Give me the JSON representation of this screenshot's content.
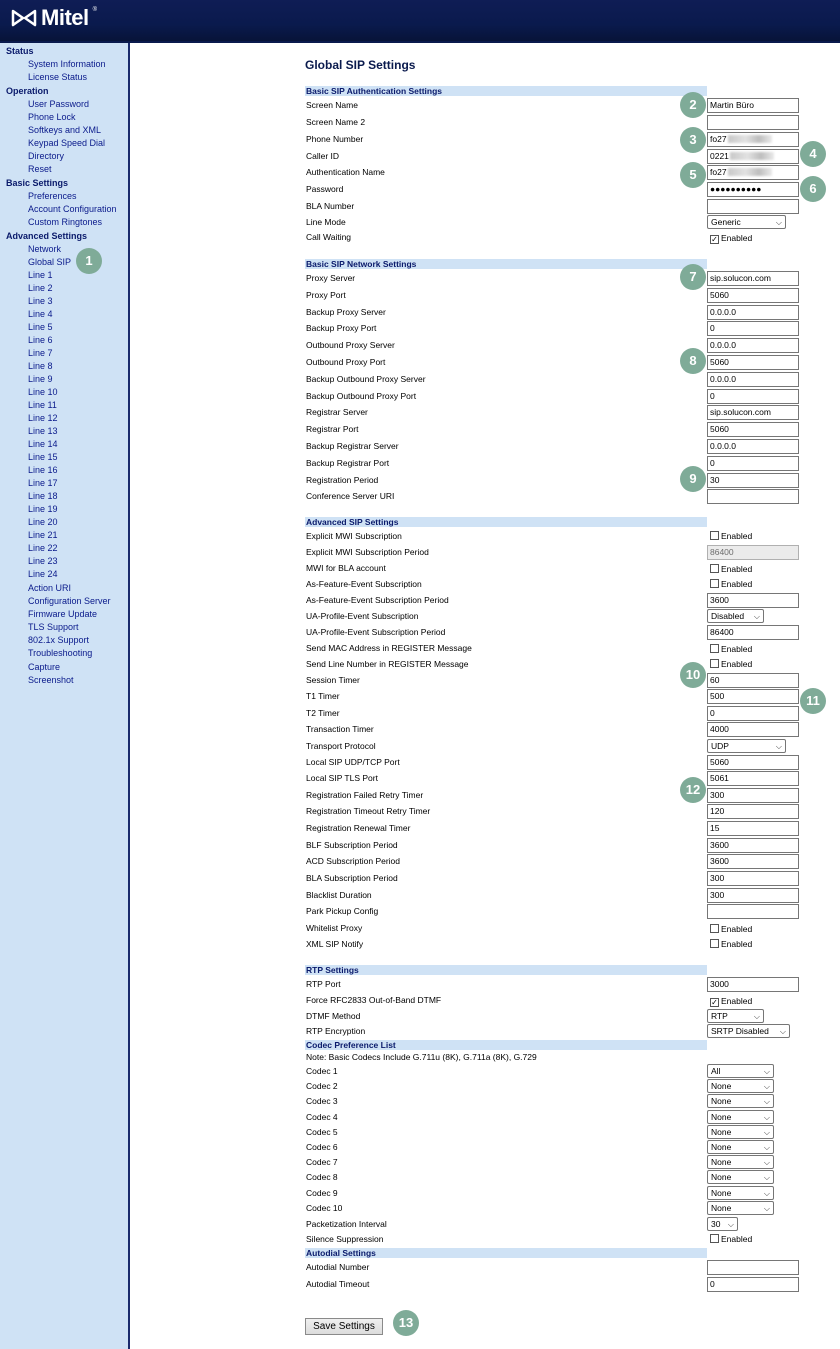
{
  "brand": {
    "name": "Mitel"
  },
  "page_title": "Global SIP Settings",
  "sidebar": {
    "sections": [
      {
        "title": "Status",
        "items": [
          "System Information",
          "License Status"
        ]
      },
      {
        "title": "Operation",
        "items": [
          "User Password",
          "Phone Lock",
          "Softkeys and XML",
          "Keypad Speed Dial",
          "Directory",
          "Reset"
        ]
      },
      {
        "title": "Basic Settings",
        "items": [
          "Preferences",
          "Account Configuration",
          "Custom Ringtones"
        ]
      },
      {
        "title": "Advanced Settings",
        "items": [
          "Network",
          "Global SIP",
          "Line 1",
          "Line 2",
          "Line 3",
          "Line 4",
          "Line 5",
          "Line 6",
          "Line 7",
          "Line 8",
          "Line 9",
          "Line 10",
          "Line 11",
          "Line 12",
          "Line 13",
          "Line 14",
          "Line 15",
          "Line 16",
          "Line 17",
          "Line 18",
          "Line 19",
          "Line 20",
          "Line 21",
          "Line 22",
          "Line 23",
          "Line 24",
          "Action URI",
          "Configuration Server",
          "Firmware Update",
          "TLS Support",
          "802.1x Support",
          "Troubleshooting",
          "Capture",
          "Screenshot"
        ]
      }
    ]
  },
  "enabled_label": "Enabled",
  "auth": {
    "title": "Basic SIP Authentication Settings",
    "screen_name_label": "Screen Name",
    "screen_name": "Martin Büro",
    "screen_name2_label": "Screen Name 2",
    "screen_name2": "",
    "phone_number_label": "Phone Number",
    "phone_number": "fo27",
    "caller_id_label": "Caller ID",
    "caller_id": "0221",
    "auth_name_label": "Authentication Name",
    "auth_name": "fo27",
    "password_label": "Password",
    "password": "●●●●●●●●●●",
    "bla_number_label": "BLA Number",
    "bla_number": "",
    "line_mode_label": "Line Mode",
    "line_mode": "Generic",
    "call_waiting_label": "Call Waiting"
  },
  "network": {
    "title": "Basic SIP Network Settings",
    "rows": [
      {
        "label": "Proxy Server",
        "value": "sip.solucon.com"
      },
      {
        "label": "Proxy Port",
        "value": "5060"
      },
      {
        "label": "Backup Proxy Server",
        "value": "0.0.0.0"
      },
      {
        "label": "Backup Proxy Port",
        "value": "0"
      },
      {
        "label": "Outbound Proxy Server",
        "value": "0.0.0.0"
      },
      {
        "label": "Outbound Proxy Port",
        "value": "5060"
      },
      {
        "label": "Backup Outbound Proxy Server",
        "value": "0.0.0.0"
      },
      {
        "label": "Backup Outbound Proxy Port",
        "value": "0"
      },
      {
        "label": "Registrar Server",
        "value": "sip.solucon.com"
      },
      {
        "label": "Registrar Port",
        "value": "5060"
      },
      {
        "label": "Backup Registrar Server",
        "value": "0.0.0.0"
      },
      {
        "label": "Backup Registrar Port",
        "value": "0"
      },
      {
        "label": "Registration Period",
        "value": "30"
      },
      {
        "label": "Conference Server URI",
        "value": ""
      }
    ]
  },
  "advanced": {
    "title": "Advanced SIP Settings",
    "explicit_mwi_label": "Explicit MWI Subscription",
    "explicit_mwi_period_label": "Explicit MWI Subscription Period",
    "explicit_mwi_period": "86400",
    "mwi_bla_label": "MWI for BLA account",
    "as_feature_label": "As-Feature-Event Subscription",
    "as_feature_period_label": "As-Feature-Event Subscription Period",
    "as_feature_period": "3600",
    "ua_profile_label": "UA-Profile-Event Subscription",
    "ua_profile": "Disabled",
    "ua_profile_period_label": "UA-Profile-Event Subscription Period",
    "ua_profile_period": "86400",
    "send_mac_label": "Send MAC Address in REGISTER Message",
    "send_line_label": "Send Line Number in REGISTER Message",
    "session_timer_label": "Session Timer",
    "session_timer": "60",
    "t1_timer_label": "T1 Timer",
    "t1_timer": "500",
    "t2_timer_label": "T2 Timer",
    "t2_timer": "0",
    "transaction_timer_label": "Transaction Timer",
    "transaction_timer": "4000",
    "transport_label": "Transport Protocol",
    "transport": "UDP",
    "udp_port_label": "Local SIP UDP/TCP Port",
    "udp_port": "5060",
    "tls_port_label": "Local SIP TLS Port",
    "tls_port": "5061",
    "reg_failed_label": "Registration Failed Retry Timer",
    "reg_failed": "300",
    "reg_timeout_label": "Registration Timeout Retry Timer",
    "reg_timeout": "120",
    "reg_renewal_label": "Registration Renewal Timer",
    "reg_renewal": "15",
    "blf_period_label": "BLF Subscription Period",
    "blf_period": "3600",
    "acd_period_label": "ACD Subscription Period",
    "acd_period": "3600",
    "bla_period_label": "BLA Subscription Period",
    "bla_period": "300",
    "blacklist_label": "Blacklist Duration",
    "blacklist": "300",
    "park_pickup_label": "Park Pickup Config",
    "park_pickup": "",
    "whitelist_label": "Whitelist Proxy",
    "xml_notify_label": "XML SIP Notify"
  },
  "rtp": {
    "title": "RTP Settings",
    "rtp_port_label": "RTP Port",
    "rtp_port": "3000",
    "force_dtmf_label": "Force RFC2833 Out-of-Band DTMF",
    "dtmf_method_label": "DTMF Method",
    "dtmf_method": "RTP",
    "encryption_label": "RTP Encryption",
    "encryption": "SRTP Disabled"
  },
  "codec": {
    "title": "Codec Preference List",
    "note": "Note: Basic Codecs Include G.711u (8K), G.711a (8K), G.729",
    "codecs": [
      {
        "label": "Codec 1",
        "value": "All"
      },
      {
        "label": "Codec 2",
        "value": "None"
      },
      {
        "label": "Codec 3",
        "value": "None"
      },
      {
        "label": "Codec 4",
        "value": "None"
      },
      {
        "label": "Codec 5",
        "value": "None"
      },
      {
        "label": "Codec 6",
        "value": "None"
      },
      {
        "label": "Codec 7",
        "value": "None"
      },
      {
        "label": "Codec 8",
        "value": "None"
      },
      {
        "label": "Codec 9",
        "value": "None"
      },
      {
        "label": "Codec 10",
        "value": "None"
      }
    ],
    "packetization_label": "Packetization Interval",
    "packetization": "30",
    "silence_label": "Silence Suppression"
  },
  "autodial": {
    "title": "Autodial Settings",
    "number_label": "Autodial Number",
    "number": "",
    "timeout_label": "Autodial Timeout",
    "timeout": "0"
  },
  "save_label": "Save Settings",
  "badges": [
    "1",
    "2",
    "3",
    "4",
    "5",
    "6",
    "7",
    "8",
    "9",
    "10",
    "11",
    "12",
    "13"
  ]
}
